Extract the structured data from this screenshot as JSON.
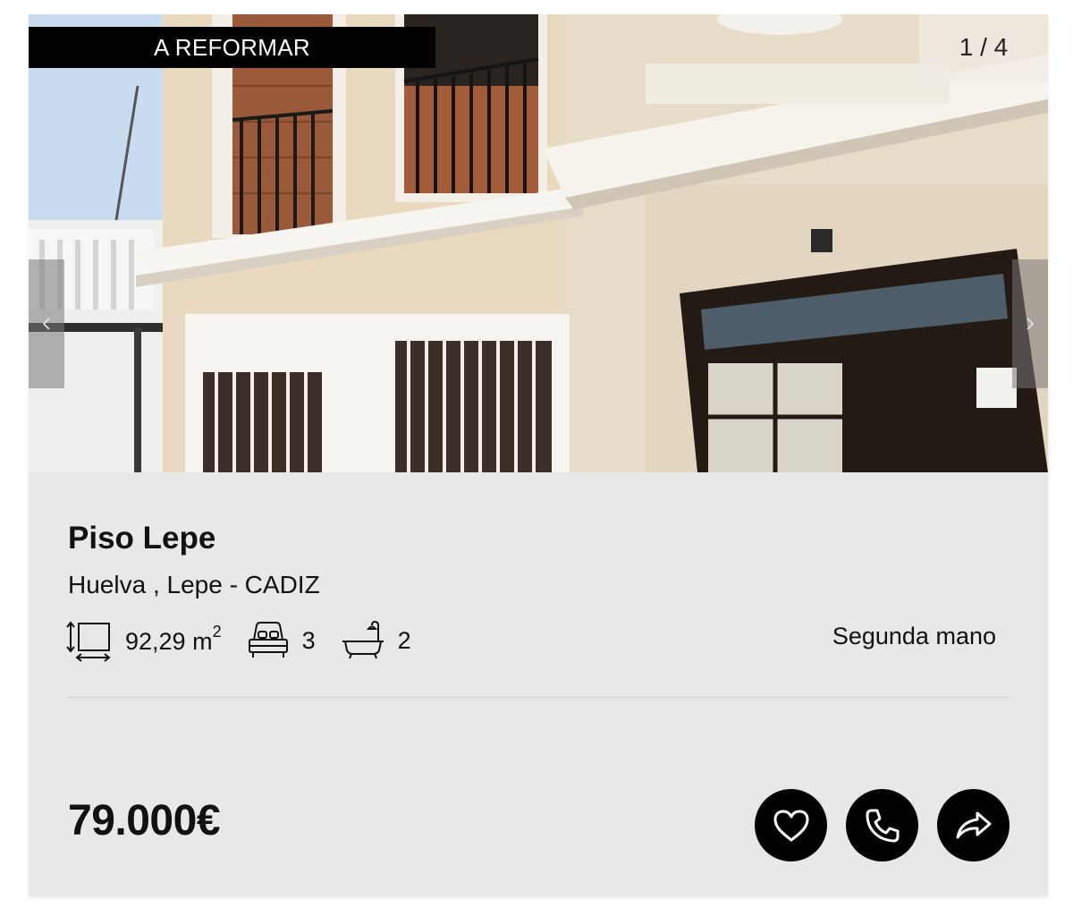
{
  "listing": {
    "badge": "A REFORMAR",
    "photo_counter": "1 / 4",
    "title": "Piso Lepe",
    "location": "Huelva , Lepe - CADIZ",
    "area_value": "92,29 m",
    "area_unit_exp": "2",
    "bedrooms": "3",
    "bathrooms": "2",
    "condition": "Segunda mano",
    "price": "79.000€"
  },
  "icons": {
    "prev": "chevron-left-icon",
    "next": "chevron-right-icon",
    "area": "area-icon",
    "bed": "bed-icon",
    "bath": "bathtub-icon",
    "favorite": "heart-icon",
    "call": "phone-icon",
    "share": "share-icon"
  },
  "colors": {
    "card_background": "#e9e8e8",
    "badge_background": "#000000",
    "action_buttons": "#000000"
  }
}
